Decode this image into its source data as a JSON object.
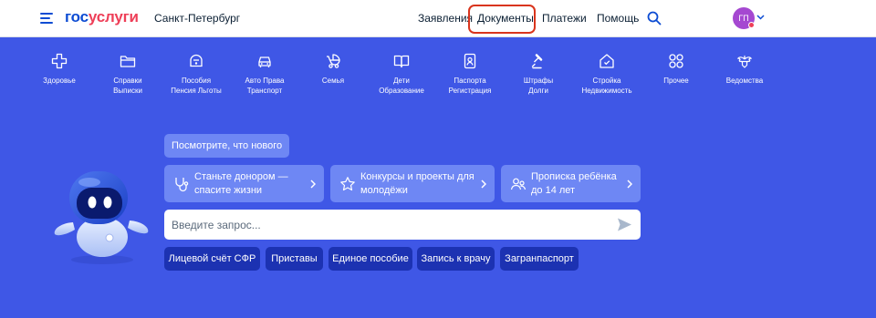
{
  "header": {
    "logo_part1": "гос",
    "logo_part2": "услуги",
    "city": "Санкт-Петербург",
    "nav": [
      {
        "label": "Заявления"
      },
      {
        "label": "Документы"
      },
      {
        "label": "Платежи"
      },
      {
        "label": "Помощь"
      }
    ],
    "avatar_initials": "ГП",
    "icons": {
      "menu": "burger-menu-icon",
      "search": "search-icon",
      "caret": "chevron-down-icon"
    }
  },
  "services": [
    {
      "label": "Здоровье",
      "icon": "health-cross-icon"
    },
    {
      "label": "Справки\nВыписки",
      "icon": "folder-icon"
    },
    {
      "label": "Пособия\nПенсия Льготы",
      "icon": "wallet-icon"
    },
    {
      "label": "Авто Права\nТранспорт",
      "icon": "car-icon"
    },
    {
      "label": "Семья",
      "icon": "stroller-icon"
    },
    {
      "label": "Дети\nОбразование",
      "icon": "book-icon"
    },
    {
      "label": "Паспорта\nРегистрация",
      "icon": "passport-icon"
    },
    {
      "label": "Штрафы\nДолги",
      "icon": "gavel-icon"
    },
    {
      "label": "Стройка\nНедвижимость",
      "icon": "house-icon"
    },
    {
      "label": "Прочее",
      "icon": "grid-icon"
    },
    {
      "label": "Ведомства",
      "icon": "emblem-icon"
    }
  ],
  "news_button": "Посмотрите, что нового",
  "cards": [
    {
      "text": "Станьте донором —\nспасите жизни",
      "icon": "stethoscope-icon"
    },
    {
      "text": "Конкурсы и проекты для\nмолодёжи",
      "icon": "star-icon"
    },
    {
      "text": "Прописка ребёнка\nдо 14 лет",
      "icon": "people-icon"
    }
  ],
  "search": {
    "placeholder": "Введите запрос...",
    "value": ""
  },
  "quick_chips": [
    {
      "label": "Лицевой счёт СФР"
    },
    {
      "label": "Приставы"
    },
    {
      "label": "Единое пособие"
    },
    {
      "label": "Запись к врачу"
    },
    {
      "label": "Загранпаспорт"
    }
  ],
  "colors": {
    "background": "#3f57e6",
    "card": "#6e87f4",
    "chip": "#1c32b2",
    "brand_blue": "#0d4cd3",
    "brand_red": "#ee3f58",
    "highlight_frame": "#d9341c",
    "avatar": "#a548d1"
  }
}
